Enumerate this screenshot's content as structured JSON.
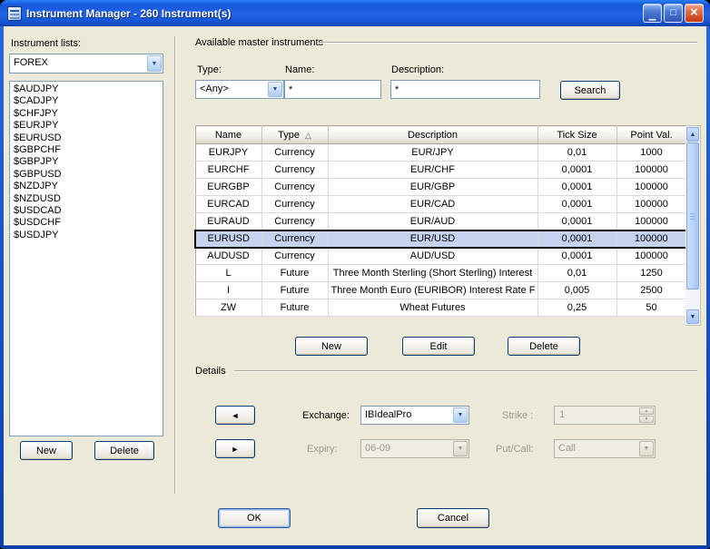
{
  "window": {
    "title": "Instrument Manager - 260 Instrument(s)"
  },
  "icons": {
    "minimize": "▁",
    "maximize": "□",
    "close": "×",
    "combo_arrow": "▼",
    "sort_asc": "△",
    "scroll_up": "▲",
    "scroll_down": "▼",
    "spin_up": "▲",
    "spin_down": "▼",
    "prev": "◄",
    "next": "►"
  },
  "left_panel": {
    "label": "Instrument lists:",
    "list_combo_value": "FOREX",
    "items": [
      "$AUDJPY",
      "$CADJPY",
      "$CHFJPY",
      "$EURJPY",
      "$EURUSD",
      "$GBPCHF",
      "$GBPJPY",
      "$GBPUSD",
      "$NZDJPY",
      "$NZDUSD",
      "$USDCAD",
      "$USDCHF",
      "$USDJPY"
    ],
    "buttons": {
      "new": "New",
      "delete": "Delete"
    }
  },
  "filters": {
    "group_label": "Available master instruments",
    "type_label": "Type:",
    "type_value": "<Any>",
    "name_label": "Name:",
    "name_value": "*",
    "description_label": "Description:",
    "description_value": "*",
    "search_label": "Search"
  },
  "table": {
    "columns": [
      "Name",
      "Type",
      "Description",
      "Tick Size",
      "Point Val."
    ],
    "selected_row": "EURUSD",
    "rows": [
      {
        "name": "EURJPY",
        "type": "Currency",
        "description": "EUR/JPY",
        "tick_size": "0,01",
        "point_val": "1000"
      },
      {
        "name": "EURCHF",
        "type": "Currency",
        "description": "EUR/CHF",
        "tick_size": "0,0001",
        "point_val": "100000"
      },
      {
        "name": "EURGBP",
        "type": "Currency",
        "description": "EUR/GBP",
        "tick_size": "0,0001",
        "point_val": "100000"
      },
      {
        "name": "EURCAD",
        "type": "Currency",
        "description": "EUR/CAD",
        "tick_size": "0,0001",
        "point_val": "100000"
      },
      {
        "name": "EURAUD",
        "type": "Currency",
        "description": "EUR/AUD",
        "tick_size": "0,0001",
        "point_val": "100000"
      },
      {
        "name": "EURUSD",
        "type": "Currency",
        "description": "EUR/USD",
        "tick_size": "0,0001",
        "point_val": "100000"
      },
      {
        "name": "AUDUSD",
        "type": "Currency",
        "description": "AUD/USD",
        "tick_size": "0,0001",
        "point_val": "100000"
      },
      {
        "name": "L",
        "type": "Future",
        "description": "Three Month Sterling (Short Sterling) Interest",
        "tick_size": "0,01",
        "point_val": "1250"
      },
      {
        "name": "I",
        "type": "Future",
        "description": "Three Month Euro (EURIBOR) Interest Rate F",
        "tick_size": "0,005",
        "point_val": "2500"
      },
      {
        "name": "ZW",
        "type": "Future",
        "description": "Wheat Futures",
        "tick_size": "0,25",
        "point_val": "50"
      }
    ]
  },
  "table_buttons": {
    "new": "New",
    "edit": "Edit",
    "delete": "Delete"
  },
  "details": {
    "group_label": "Details",
    "exchange_label": "Exchange:",
    "exchange_value": "IBIdealPro",
    "strike_label": "Strike :",
    "strike_value": "1",
    "expiry_label": "Expiry:",
    "expiry_value": "06-09",
    "putcall_label": "Put/Call:",
    "putcall_value": "Call"
  },
  "footer": {
    "ok": "OK",
    "cancel": "Cancel"
  },
  "colors": {
    "titlebar_blue": "#1557d8",
    "window_bg": "#ECE9D8",
    "selection_bg": "#C6D3EE",
    "field_border": "#7F9DB9"
  }
}
